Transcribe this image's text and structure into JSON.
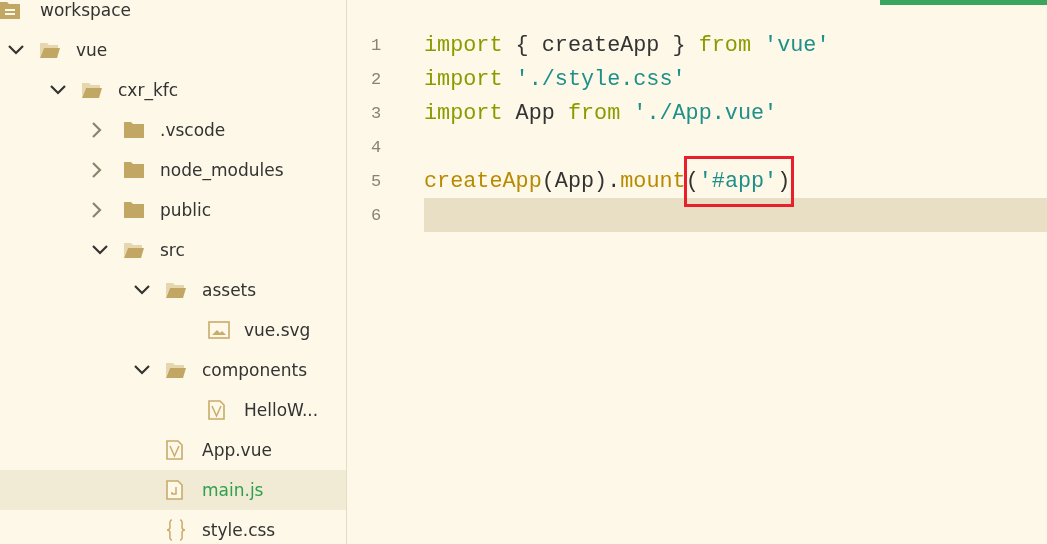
{
  "workspace": {
    "label": "workspace"
  },
  "tree": [
    {
      "kind": "folder",
      "name": "vue",
      "expanded": true,
      "selected": false,
      "children": [
        {
          "kind": "folder",
          "name": "cxr_kfc",
          "expanded": true,
          "selected": false,
          "children": [
            {
              "kind": "folder",
              "name": ".vscode",
              "expanded": false,
              "selected": false
            },
            {
              "kind": "folder",
              "name": "node_modules",
              "expanded": false,
              "selected": false
            },
            {
              "kind": "folder",
              "name": "public",
              "expanded": false,
              "selected": false
            },
            {
              "kind": "folder",
              "name": "src",
              "expanded": true,
              "selected": false,
              "children": [
                {
                  "kind": "folder",
                  "name": "assets",
                  "expanded": true,
                  "selected": false,
                  "children": [
                    {
                      "kind": "image",
                      "name": "vue.svg",
                      "selected": false
                    }
                  ]
                },
                {
                  "kind": "folder",
                  "name": "components",
                  "expanded": true,
                  "selected": false,
                  "children": [
                    {
                      "kind": "vue",
                      "name": "HelloW...",
                      "selected": false
                    }
                  ]
                },
                {
                  "kind": "vue",
                  "name": "App.vue",
                  "selected": false
                },
                {
                  "kind": "js",
                  "name": "main.js",
                  "selected": true
                },
                {
                  "kind": "css",
                  "name": "style.css",
                  "selected": false
                }
              ]
            }
          ]
        }
      ]
    }
  ],
  "editor": {
    "lines": [
      {
        "number": "1",
        "current": false,
        "tokens": [
          {
            "kind": "keyword",
            "text": "import"
          },
          {
            "kind": "plain",
            "text": " { createApp } "
          },
          {
            "kind": "keyword",
            "text": "from"
          },
          {
            "kind": "string",
            "text": " 'vue'"
          }
        ]
      },
      {
        "number": "2",
        "current": false,
        "tokens": [
          {
            "kind": "keyword",
            "text": "import"
          },
          {
            "kind": "string",
            "text": " './style.css'"
          }
        ]
      },
      {
        "number": "3",
        "current": false,
        "tokens": [
          {
            "kind": "keyword",
            "text": "import"
          },
          {
            "kind": "plain",
            "text": " App "
          },
          {
            "kind": "keyword",
            "text": "from"
          },
          {
            "kind": "string",
            "text": " './App.vue'"
          }
        ]
      },
      {
        "number": "4",
        "current": false
      },
      {
        "number": "5",
        "current": false,
        "tokens": [
          {
            "kind": "function",
            "text": "createApp"
          },
          {
            "kind": "plain",
            "text": "(App)."
          },
          {
            "kind": "function",
            "text": "mount"
          }
        ],
        "annotation": {
          "tokens": [
            {
              "kind": "plain",
              "text": "("
            },
            {
              "kind": "string",
              "text": "'#app'"
            },
            {
              "kind": "plain",
              "text": ")"
            }
          ]
        }
      },
      {
        "number": "6",
        "current": true
      }
    ]
  }
}
